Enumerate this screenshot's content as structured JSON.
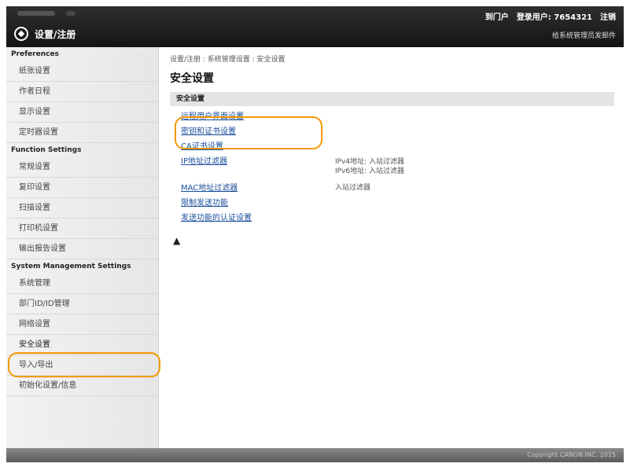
{
  "header": {
    "model_name": "",
    "links": [
      "到门户",
      "登录用户: 7654321",
      "注销"
    ],
    "app_title": "设置/注册",
    "mail_link": "给系统管理员发邮件"
  },
  "sidebar": {
    "groups": [
      {
        "title": "Preferences",
        "items": [
          "纸张设置",
          "作者日程",
          "显示设置",
          "定时器设置"
        ]
      },
      {
        "title": "Function Settings",
        "items": [
          "常规设置",
          "复印设置",
          "扫描设置",
          "打印机设置",
          "输出报告设置"
        ]
      },
      {
        "title": "System Management Settings",
        "items": [
          "系统管理",
          "部门ID/ID管理",
          "网络设置",
          "安全设置",
          "导入/导出",
          "初始化设置/信息"
        ]
      }
    ],
    "selected": "安全设置"
  },
  "main": {
    "breadcrumb": "设置/注册 : 系统管理设置 : 安全设置",
    "title": "安全设置",
    "section_header": "安全设置",
    "links": [
      {
        "label": "远程用户界面设置",
        "note": ""
      },
      {
        "label": "密钥和证书设置",
        "note": ""
      },
      {
        "label": "CA证书设置",
        "note": ""
      },
      {
        "label": "IP地址过滤器",
        "note": "IPv4地址: 入站过滤器\nIPv6地址: 入站过滤器"
      },
      {
        "label": "MAC地址过滤器",
        "note": "入站过滤器"
      },
      {
        "label": "限制发送功能",
        "note": ""
      },
      {
        "label": "发送功能的认证设置",
        "note": ""
      }
    ],
    "top_link": "▲"
  },
  "footer": {
    "copyright": "Copyright CANON INC. 2015"
  },
  "colors": {
    "highlight": "#f39800",
    "link": "#1a4f9c",
    "header_bg": "#1f1f1f"
  }
}
